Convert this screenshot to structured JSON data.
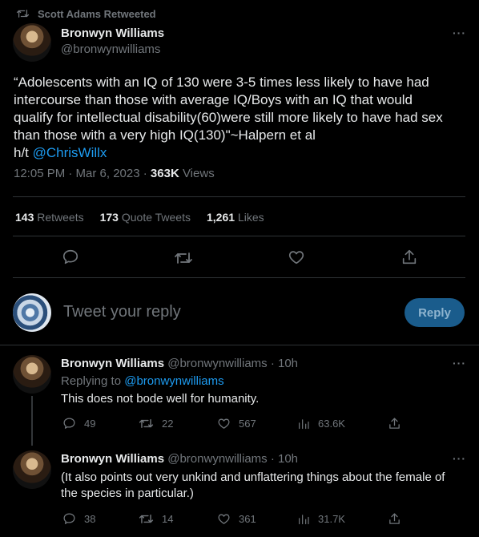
{
  "retweet": {
    "label": "Scott Adams Retweeted"
  },
  "main_tweet": {
    "author_name": "Bronwyn Williams",
    "author_handle": "@bronwynwilliams",
    "more": "···",
    "text_line1": "“Adolescents with an IQ of 130 were 3-5 times less likely to have had",
    "text_line2": "intercourse than those with average IQ/Boys with an IQ that would",
    "text_line3": "qualify for intellectual disability(60)were still more likely to have had sex",
    "text_line4": "than those with a very high IQ(130)\"~Halpern et al",
    "text_ht": "h/t ",
    "text_mention": "@ChrisWillx",
    "time": "12:05 PM · Mar 6, 2023 · ",
    "views_count": "363K",
    "views_label": " Views",
    "retweets_count": "143",
    "retweets_label": " Retweets",
    "quotes_count": "173",
    "quotes_label": " Quote Tweets",
    "likes_count": "1,261",
    "likes_label": " Likes"
  },
  "reply_box": {
    "placeholder": "Tweet your reply",
    "button": "Reply"
  },
  "replies": [
    {
      "author_name": "Bronwyn Williams",
      "author_handle": "@bronwynwilliams",
      "age": " · 10h",
      "replying_prefix": "Replying to ",
      "replying_to": "@bronwynwilliams",
      "text": "This does not bode well for humanity.",
      "replies": "49",
      "retweets": "22",
      "likes": "567",
      "views": "63.6K"
    },
    {
      "author_name": "Bronwyn Williams",
      "author_handle": "@bronwynwilliams",
      "age": " · 10h",
      "text_line1": "(It also points out very unkind and unflattering things about the female of",
      "text_line2": "the species in particular.)",
      "replies": "38",
      "retweets": "14",
      "likes": "361",
      "views": "31.7K"
    }
  ],
  "colors": {
    "background": "#000000",
    "text": "#e7e9ea",
    "secondary": "#71767b",
    "link": "#1d9bf0",
    "reply_button": "#1a5c8c",
    "divider": "#2f3336"
  }
}
